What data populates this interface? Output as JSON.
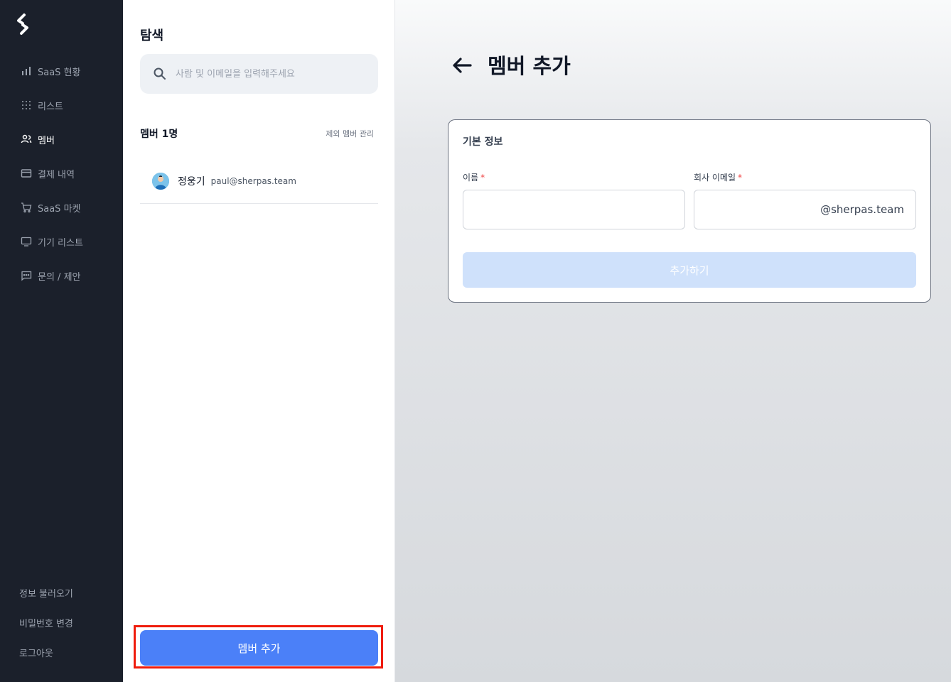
{
  "sidebar": {
    "logo": "sherpas-logo",
    "nav": [
      {
        "label": "SaaS 현황",
        "icon": "bar-chart-icon",
        "active": false
      },
      {
        "label": "리스트",
        "icon": "grid-dots-icon",
        "active": false
      },
      {
        "label": "멤버",
        "icon": "users-icon",
        "active": true
      },
      {
        "label": "결제 내역",
        "icon": "credit-card-icon",
        "active": false
      },
      {
        "label": "SaaS 마켓",
        "icon": "cart-icon",
        "active": false
      },
      {
        "label": "기기 리스트",
        "icon": "monitor-icon",
        "active": false
      },
      {
        "label": "문의 / 제안",
        "icon": "chat-icon",
        "active": false
      }
    ],
    "bottom": {
      "load_info": "정보 불러오기",
      "change_password": "비밀번호 변경",
      "logout": "로그아웃"
    }
  },
  "explore": {
    "title": "탐색",
    "search_placeholder": "사람 및 이메일을 입력해주세요",
    "member_count": "멤버 1명",
    "manage_excluded": "제외 멤버 관리",
    "members": [
      {
        "name": "정웅기",
        "email": "paul@sherpas.team"
      }
    ],
    "add_member_button": "멤버 추가"
  },
  "form": {
    "page_title": "멤버 추가",
    "section_title": "기본 정보",
    "name_label": "이름",
    "email_label": "회사 이메일",
    "required_mark": "*",
    "email_domain": "@sherpas.team",
    "submit_label": "추가하기"
  },
  "colors": {
    "sidebar_bg": "#1b202b",
    "primary": "#4b80f8",
    "primary_disabled": "#cfe1fb",
    "highlight_outline": "#ef1c0c",
    "required": "#ef4444"
  }
}
